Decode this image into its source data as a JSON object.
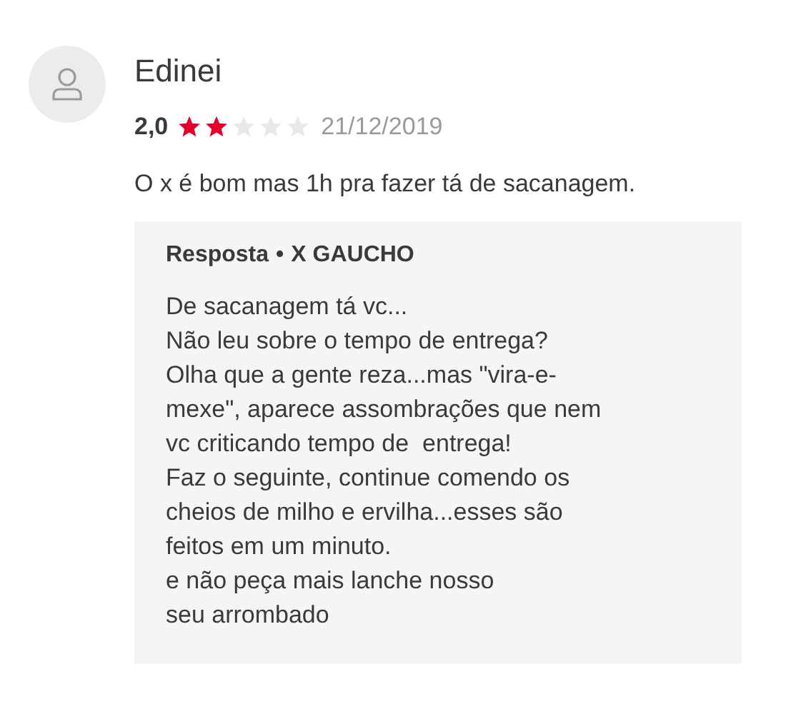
{
  "review": {
    "author": "Edinei",
    "rating": "2,0",
    "stars": 2,
    "date": "21/12/2019",
    "text": "O x é bom mas 1h pra fazer tá de sacanagem."
  },
  "response": {
    "label": "Resposta",
    "separator": "•",
    "store": "X GAUCHO",
    "lines": [
      "De sacanagem tá vc...",
      "Não leu sobre o tempo de entrega?",
      "Olha que a gente reza...mas \"vira-e-",
      "mexe\", aparece assombrações que nem",
      "vc criticando tempo de  entrega!",
      "Faz o seguinte, continue comendo os",
      "cheios de milho e ervilha...esses são",
      "feitos em um minuto.",
      "e não peça mais lanche nosso",
      "seu arrombado"
    ]
  }
}
